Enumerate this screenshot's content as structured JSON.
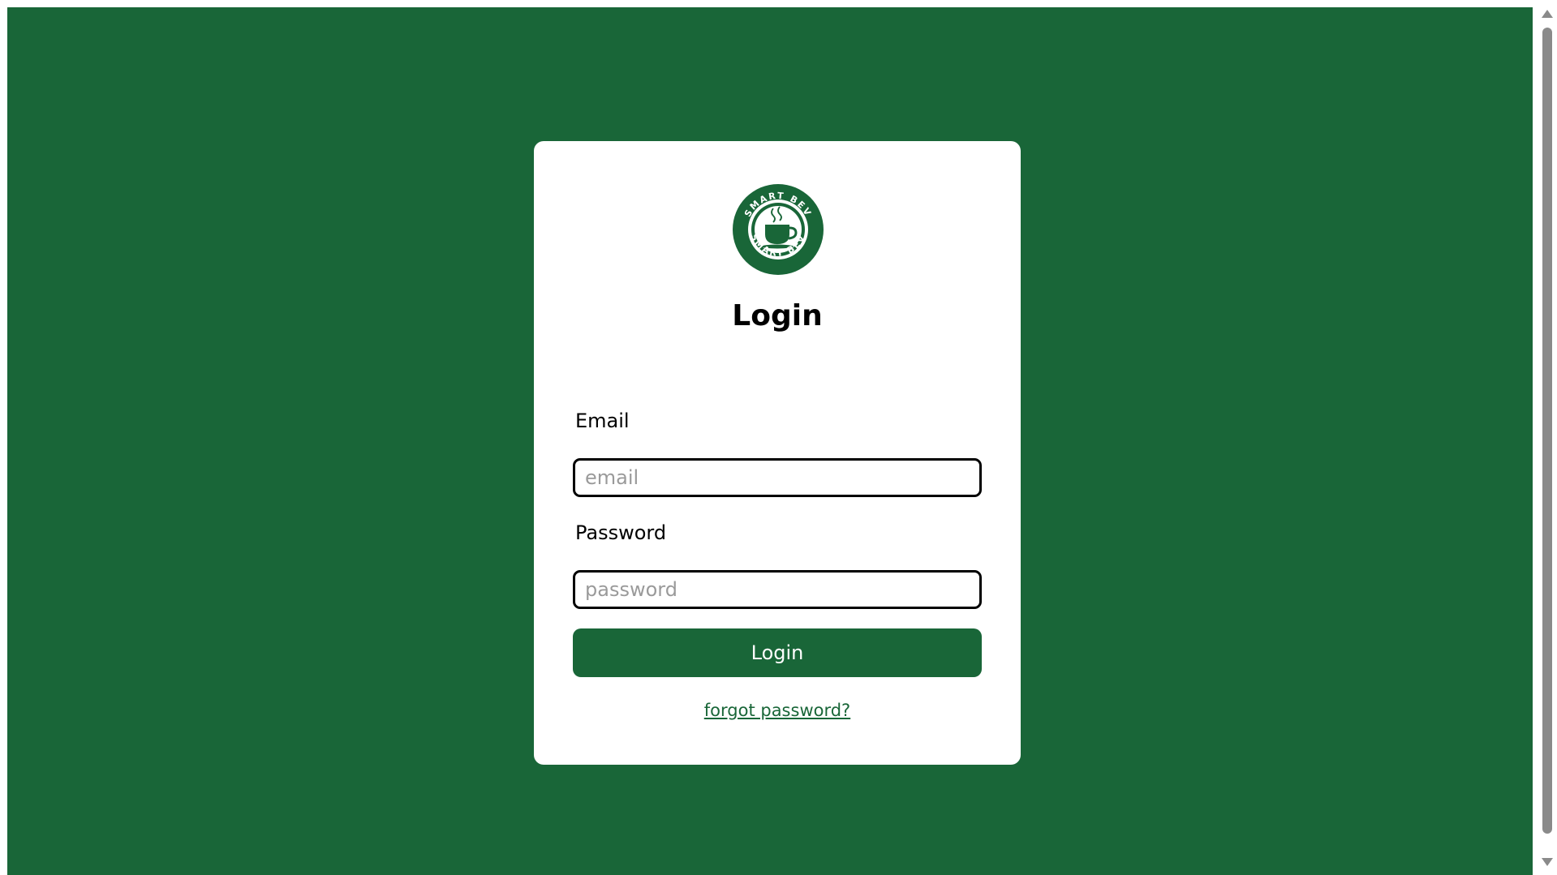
{
  "login": {
    "logo_icon": "smart-bev-coffee-logo",
    "logo_text": "SMART BEV",
    "title": "Login",
    "email_label": "Email",
    "email_placeholder": "email",
    "email_value": "",
    "password_label": "Password",
    "password_placeholder": "password",
    "password_value": "",
    "submit_label": "Login",
    "forgot_label": "forgot password?"
  },
  "colors": {
    "brand_green": "#196638",
    "card_background": "#ffffff",
    "text": "#000000",
    "placeholder": "#9a9a9a"
  }
}
